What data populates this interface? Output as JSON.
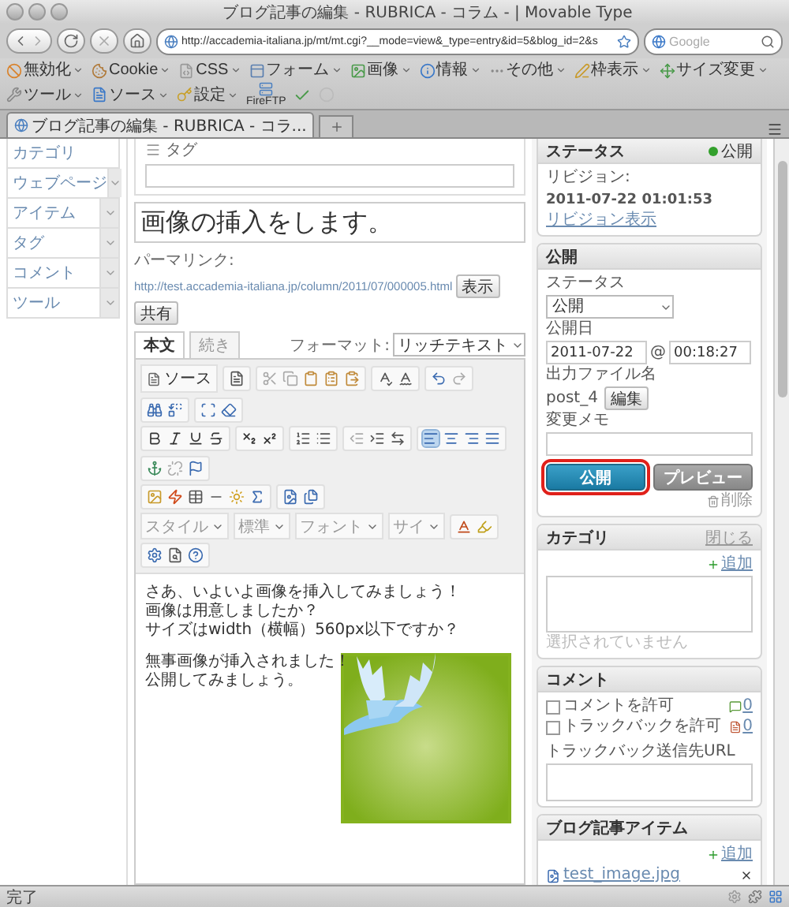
{
  "browser": {
    "title": "ブログ記事の編集 - RUBRICA - コラム - | Movable Type",
    "url": "http://accademia-italiana.jp/mt/mt.cgi?__mode=view&_type=entry&id=5&blog_id=2&s",
    "search_placeholder": "Google",
    "bookmarks": [
      {
        "label": "無効化"
      },
      {
        "label": "Cookie"
      },
      {
        "label": "CSS"
      },
      {
        "label": "フォーム"
      },
      {
        "label": "画像"
      },
      {
        "label": "情報"
      },
      {
        "label": "その他"
      },
      {
        "label": "枠表示"
      },
      {
        "label": "サイズ変更"
      },
      {
        "label": "ツール"
      },
      {
        "label": "ソース"
      },
      {
        "label": "設定"
      }
    ],
    "fireftp": "FireFTP",
    "tabs": [
      {
        "label": "ブログ記事の編集 - RUBRICA - コラ...",
        "selected": true
      }
    ],
    "status": "完了"
  },
  "sidebar": {
    "items": [
      {
        "label": "カテゴリ",
        "has_menu": false
      },
      {
        "label": "ウェブページ",
        "has_menu": true
      },
      {
        "label": "アイテム",
        "has_menu": true
      },
      {
        "label": "タグ",
        "has_menu": true
      },
      {
        "label": "コメント",
        "has_menu": true
      },
      {
        "label": "ツール",
        "has_menu": true
      }
    ]
  },
  "main": {
    "tag_label": "タグ",
    "title": "画像の挿入をします。",
    "permalink": {
      "label": "パーマリンク:",
      "url": "http://test.accademia-italiana.jp/column/2011/07/000005.html",
      "buttons": [
        "表示",
        "共有"
      ]
    },
    "editor_tabs": [
      {
        "label": "本文",
        "selected": true
      },
      {
        "label": "続き",
        "selected": false
      }
    ],
    "format": {
      "label": "フォーマット:",
      "value": "リッチテキスト"
    },
    "toolbar": {
      "source_button": "ソース",
      "selects": [
        "スタイル",
        "標準",
        "フォント",
        "サイ"
      ],
      "alignments": [
        {
          "kind": "left",
          "selected": true
        },
        {
          "kind": "center",
          "selected": false
        },
        {
          "kind": "right",
          "selected": false
        },
        {
          "kind": "justify",
          "selected": false
        }
      ]
    },
    "body": {
      "paragraphs": [
        "さあ、いよいよ画像を挿入してみましょう！",
        "画像は用意しましたか？",
        "サイズはwidth（横幅）560px以下ですか？"
      ],
      "side_text": [
        "無事画像が挿入されました！",
        "公開してみましょう。"
      ],
      "image": {
        "kind": "picture"
      }
    }
  },
  "status_panel": {
    "title": "ステータス",
    "badge": {
      "label": "公開",
      "color": "#33a02c"
    },
    "revision_label": "リビジョン:",
    "revision_value": "2011-07-22 01:01:53",
    "revision_link": "リビジョン表示"
  },
  "publish_panel": {
    "title": "公開",
    "status_label": "ステータス",
    "status_value": "公開",
    "date_label": "公開日",
    "date": "2011-07-22",
    "at": "@",
    "time": "00:18:27",
    "filename_label": "出力ファイル名",
    "filename": "post_4",
    "edit_button": "編集",
    "memo_label": "変更メモ",
    "publish_button": "公開",
    "publish_highlighted": true,
    "preview_button": "プレビュー",
    "delete_link": "削除"
  },
  "category_panel": {
    "title": "カテゴリ",
    "close_link": "閉じる",
    "add_link": "追加",
    "empty_text": "選択されていません"
  },
  "comment_panel": {
    "title": "コメント",
    "options": [
      {
        "kind": "comment",
        "label": "コメントを許可",
        "checked": false,
        "count": "0"
      },
      {
        "kind": "trackback",
        "label": "トラックバックを許可",
        "checked": false,
        "count": "0"
      }
    ],
    "trackback_label": "トラックバック送信先URL"
  },
  "items_panel": {
    "title": "ブログ記事アイテム",
    "add_link": "追加",
    "files": [
      "test_image.jpg"
    ]
  }
}
